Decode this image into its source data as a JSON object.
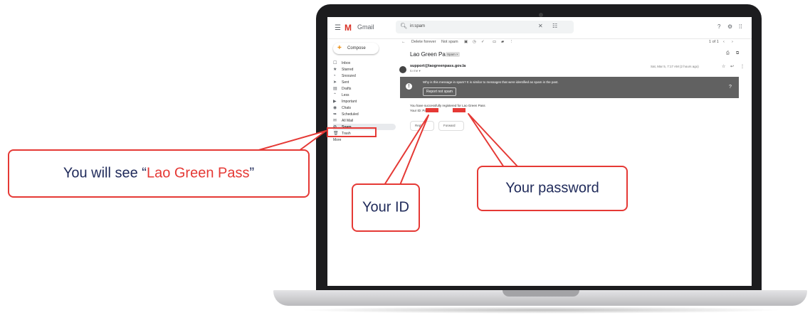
{
  "gmail": {
    "app_title": "Gmail",
    "search_value": "in:spam",
    "compose_label": "Compose",
    "nav_items": [
      {
        "label": "Inbox",
        "icon": "inbox-icon"
      },
      {
        "label": "Starred",
        "icon": "star-icon"
      },
      {
        "label": "Snoozed",
        "icon": "clock-icon"
      },
      {
        "label": "Sent",
        "icon": "send-icon"
      },
      {
        "label": "Drafts",
        "icon": "draft-icon"
      },
      {
        "label": "Less",
        "icon": "chevron-up-icon"
      },
      {
        "label": "Important",
        "icon": "important-icon"
      },
      {
        "label": "Chats",
        "icon": "chat-icon"
      },
      {
        "label": "Scheduled",
        "icon": "scheduled-icon"
      },
      {
        "label": "All Mail",
        "icon": "mail-icon"
      },
      {
        "label": "Spam",
        "icon": "spam-icon"
      },
      {
        "label": "Trash",
        "icon": "trash-icon"
      },
      {
        "label": "More",
        "icon": ""
      }
    ],
    "toolbar": {
      "delete_forever": "Delete forever",
      "not_spam": "Not spam",
      "count": "1 of 1"
    },
    "email": {
      "subject": "Lao Green Pass",
      "label": "Spam ×",
      "sender": "support@laogreenpass.gov.la",
      "to_me": "to me ▾",
      "date": "Sat, Mar 5, 7:17 AM (2 hours ago)",
      "spam_message": "Why is this message in spam? It is similar to messages that were identified as spam in the past.",
      "report_not_spam": "Report not spam",
      "body_line1": "You have successfully registered for Lao Green Pass",
      "body_line2": "Your ID:                 Password:",
      "reply": "Reply",
      "forward": "Forward"
    }
  },
  "annotations": {
    "see_prefix": "You will see “",
    "see_highlight": "Lao Green Pass",
    "see_suffix": "”",
    "your_id": "Your ID",
    "your_password": "Your password"
  },
  "colors": {
    "accent_red": "#e53935",
    "text_navy": "#1f2a5a"
  }
}
